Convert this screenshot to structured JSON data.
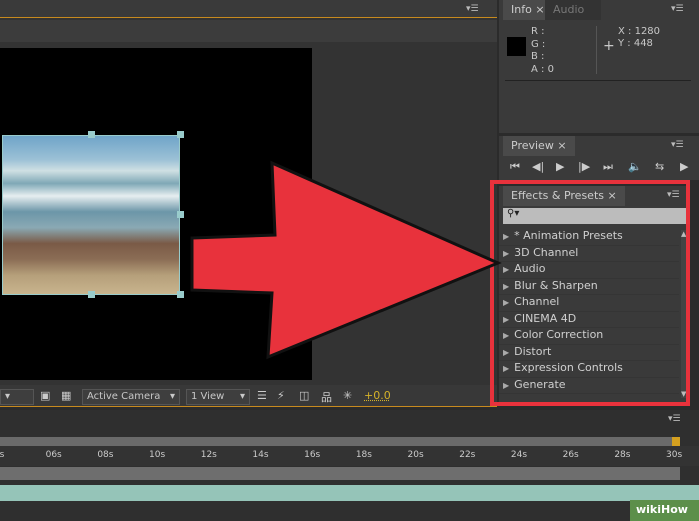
{
  "info_panel": {
    "tabs": [
      "Info",
      "Audio"
    ],
    "r": "R :",
    "g": "G :",
    "b": "B :",
    "a": "A : 0",
    "x": "X : 1280",
    "y": "Y : 448"
  },
  "preview_panel": {
    "tab": "Preview",
    "controls": [
      "first-frame",
      "prev-frame",
      "play",
      "next-frame",
      "last-frame",
      "audio",
      "loop",
      "ram-preview"
    ]
  },
  "effects_panel": {
    "tab": "Effects & Presets",
    "search_placeholder": "",
    "items": [
      "* Animation Presets",
      "3D Channel",
      "Audio",
      "Blur & Sharpen",
      "Channel",
      "CINEMA 4D",
      "Color Correction",
      "Distort",
      "Expression Controls",
      "Generate"
    ]
  },
  "viewer_toolbar": {
    "camera": "Active Camera",
    "views": "1 View",
    "exposure": "+0.0"
  },
  "timeline": {
    "ticks": [
      "s",
      "06s",
      "08s",
      "10s",
      "12s",
      "14s",
      "16s",
      "18s",
      "20s",
      "22s",
      "24s",
      "26s",
      "28s",
      "30s"
    ]
  },
  "annotation": {
    "color": "#e8323c"
  },
  "watermark": "wikiHow"
}
